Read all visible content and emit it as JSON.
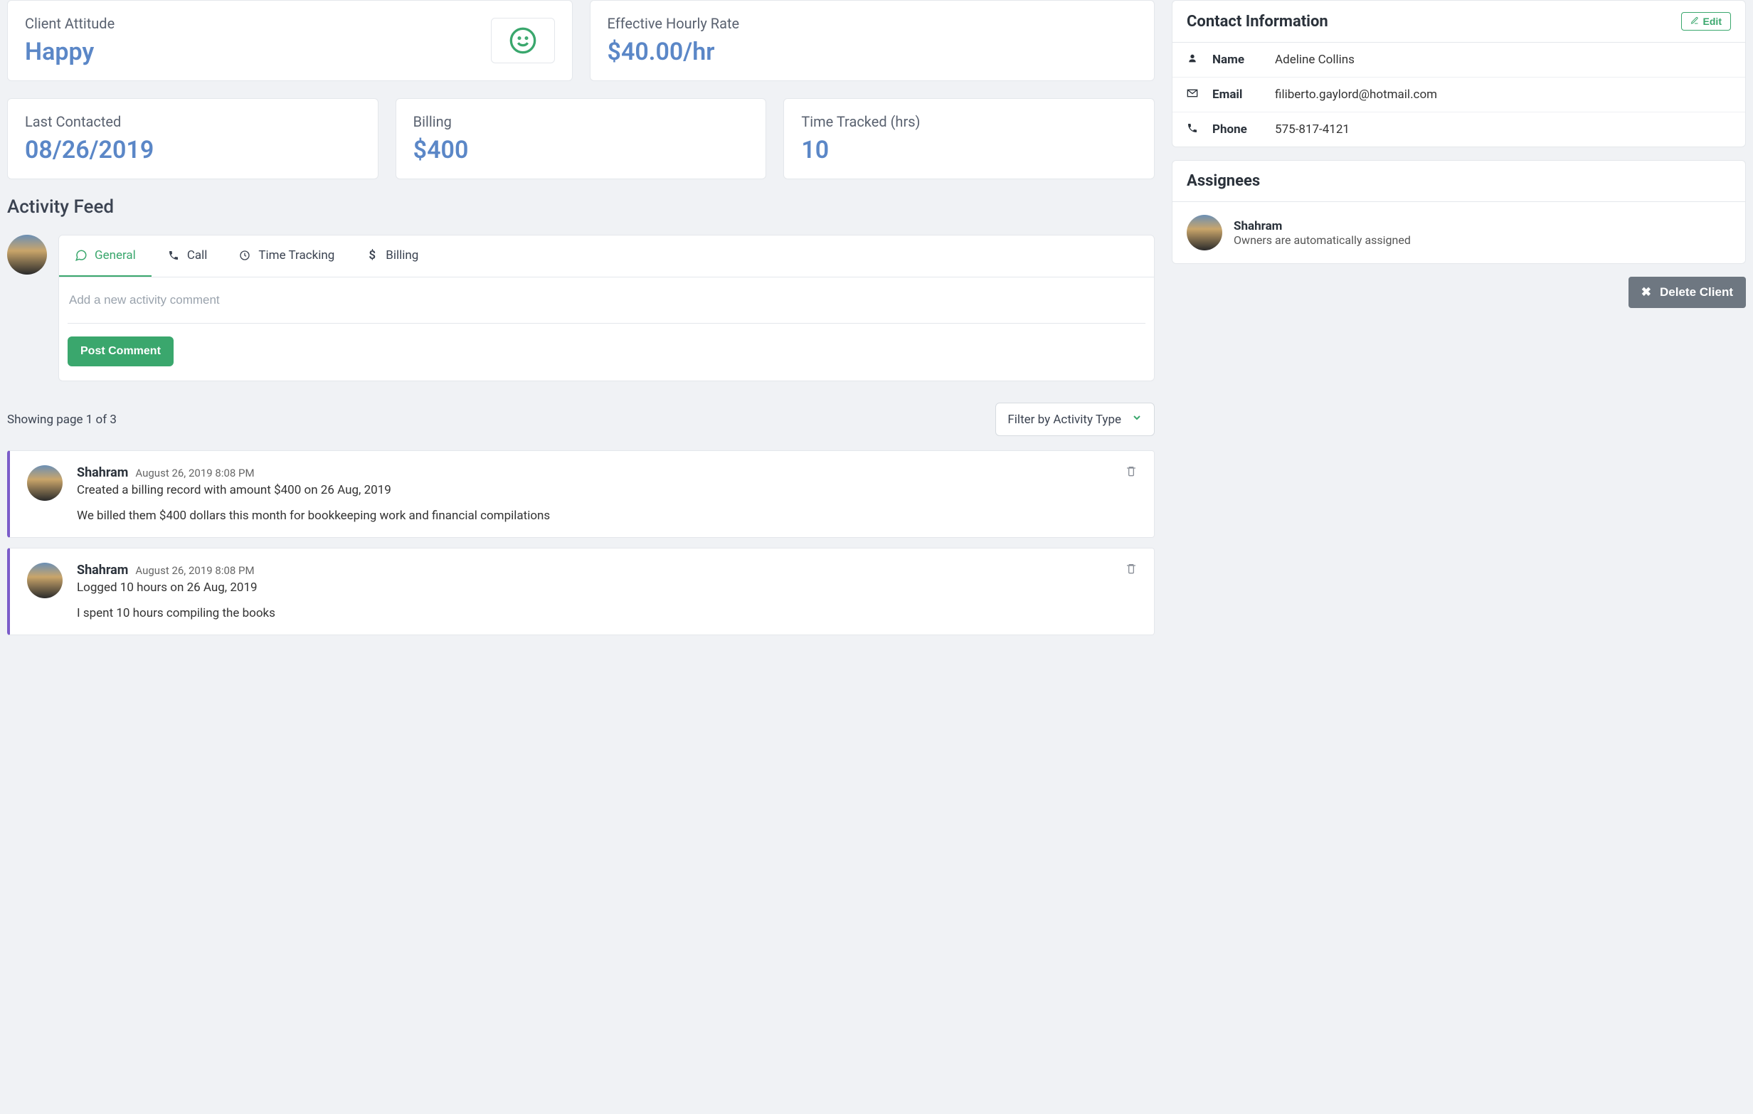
{
  "stats": {
    "attitude": {
      "label": "Client Attitude",
      "value": "Happy"
    },
    "rate": {
      "label": "Effective Hourly Rate",
      "value": "$40.00/hr"
    },
    "last_contacted": {
      "label": "Last Contacted",
      "value": "08/26/2019"
    },
    "billing": {
      "label": "Billing",
      "value": "$400"
    },
    "time_tracked": {
      "label": "Time Tracked (hrs)",
      "value": "10"
    }
  },
  "activity": {
    "title": "Activity Feed",
    "tabs": {
      "general": "General",
      "call": "Call",
      "time_tracking": "Time Tracking",
      "billing": "Billing"
    },
    "composer_placeholder": "Add a new activity comment",
    "post_button": "Post Comment",
    "page_info": "Showing page 1 of 3",
    "filter_label": "Filter by Activity Type",
    "items": [
      {
        "author": "Shahram",
        "time": "August 26, 2019 8:08 PM",
        "summary": "Created a billing record with amount $400 on 26 Aug, 2019",
        "note": "We billed them $400 dollars this month for bookkeeping work and financial compilations"
      },
      {
        "author": "Shahram",
        "time": "August 26, 2019 8:08 PM",
        "summary": "Logged 10 hours on 26 Aug, 2019",
        "note": "I spent 10 hours compiling the books"
      }
    ]
  },
  "contact": {
    "title": "Contact Information",
    "edit_label": "Edit",
    "name_label": "Name",
    "name_value": "Adeline Collins",
    "email_label": "Email",
    "email_value": "filiberto.gaylord@hotmail.com",
    "phone_label": "Phone",
    "phone_value": "575-817-4121"
  },
  "assignees": {
    "title": "Assignees",
    "name": "Shahram",
    "sub": "Owners are automatically assigned"
  },
  "delete_label": "Delete Client"
}
